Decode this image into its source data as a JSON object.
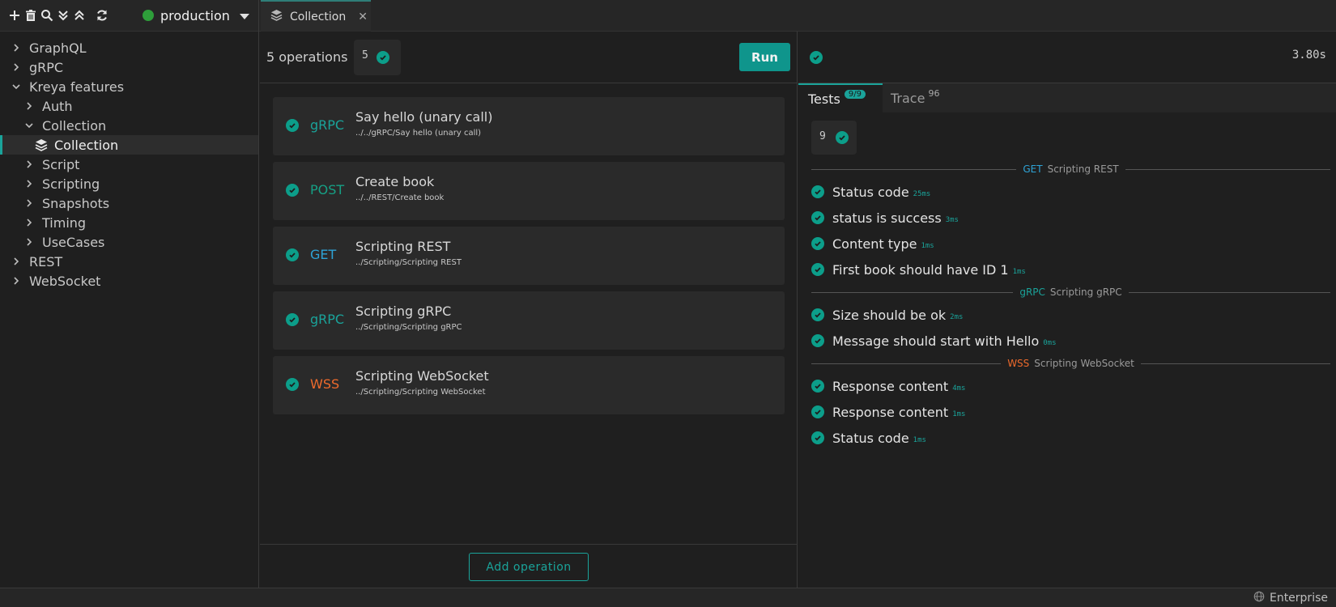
{
  "toolbar": {
    "icons": [
      "plus-icon",
      "trash-icon",
      "search-icon",
      "collapse-all-icon",
      "expand-all-icon",
      "refresh-icon"
    ],
    "environment": {
      "label": "production",
      "status_color": "#2e9e3a"
    }
  },
  "editor_tab": {
    "icon": "layers-icon",
    "label": "Collection",
    "close": "✕"
  },
  "sidebar": {
    "items": [
      {
        "label": "GraphQL",
        "expanded": false
      },
      {
        "label": "gRPC",
        "expanded": false
      },
      {
        "label": "Kreya features",
        "expanded": true
      },
      {
        "label": "Auth",
        "expanded": false
      },
      {
        "label": "Collection",
        "expanded": true
      },
      {
        "label": "Collection",
        "selected": true,
        "icon": "layers-icon"
      },
      {
        "label": "Script",
        "expanded": false
      },
      {
        "label": "Scripting",
        "expanded": false
      },
      {
        "label": "Snapshots",
        "expanded": false
      },
      {
        "label": "Timing",
        "expanded": false
      },
      {
        "label": "UseCases",
        "expanded": false
      },
      {
        "label": "REST",
        "expanded": false
      },
      {
        "label": "WebSocket",
        "expanded": false
      }
    ]
  },
  "collection": {
    "ops_count_label": "5 operations",
    "ops_badge": "5",
    "run_label": "Run",
    "operations": [
      {
        "method": "gRPC",
        "method_color": "#1aa39a",
        "title": "Say hello (unary call)",
        "path": "../../gRPC/Say hello (unary call)"
      },
      {
        "method": "POST",
        "method_color": "#16a085",
        "title": "Create book",
        "path": "../../REST/Create book"
      },
      {
        "method": "GET",
        "method_color": "#2ea3d6",
        "title": "Scripting REST",
        "path": "../Scripting/Scripting REST"
      },
      {
        "method": "gRPC",
        "method_color": "#1aa39a",
        "title": "Scripting gRPC",
        "path": "../Scripting/Scripting gRPC"
      },
      {
        "method": "WSS",
        "method_color": "#ee6a2c",
        "title": "Scripting WebSocket",
        "path": "../Scripting/Scripting WebSocket"
      }
    ],
    "add_operation_label": "Add operation"
  },
  "results": {
    "duration": "3.80s",
    "tabs": {
      "tests_label": "Tests",
      "tests_badge": "9/9",
      "trace_label": "Trace",
      "trace_count": "96"
    },
    "tests_badge": "9",
    "groups": [
      {
        "method": "GET",
        "method_color": "#2ea3d6",
        "name": "Scripting REST",
        "tests": [
          {
            "name": "Status code",
            "time": "25ms"
          },
          {
            "name": "status is success",
            "time": "3ms"
          },
          {
            "name": "Content type",
            "time": "1ms"
          },
          {
            "name": "First book should have ID 1",
            "time": "1ms"
          }
        ]
      },
      {
        "method": "gRPC",
        "method_color": "#1aa39a",
        "name": "Scripting gRPC",
        "tests": [
          {
            "name": "Size should be ok",
            "time": "2ms"
          },
          {
            "name": "Message should start with Hello",
            "time": "0ms"
          }
        ]
      },
      {
        "method": "WSS",
        "method_color": "#ee6a2c",
        "name": "Scripting WebSocket",
        "tests": [
          {
            "name": "Response content",
            "time": "4ms"
          },
          {
            "name": "Response content",
            "time": "1ms"
          },
          {
            "name": "Status code",
            "time": "1ms"
          }
        ]
      }
    ]
  },
  "statusbar": {
    "edition_icon": "globe-icon",
    "edition_label": "Enterprise"
  },
  "colors": {
    "accent": "#1aa39a",
    "success": "#0c9e8a",
    "run_button": "#0f958c"
  }
}
